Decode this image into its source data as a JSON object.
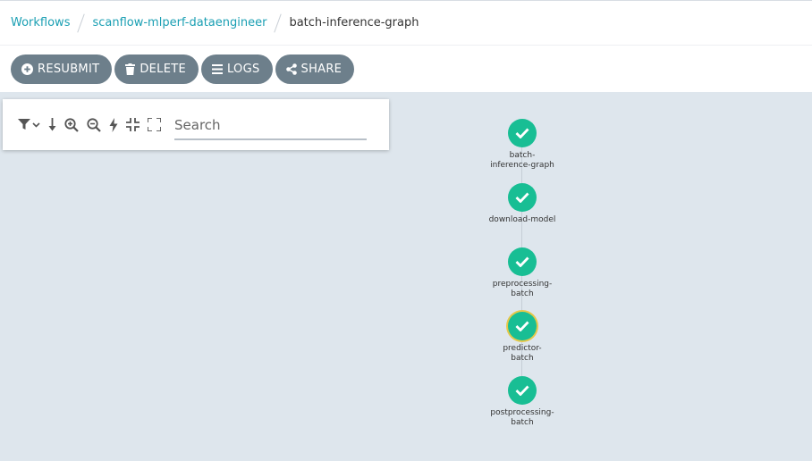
{
  "breadcrumb": {
    "root": "Workflows",
    "parent": "scanflow-mlperf-dataengineer",
    "current": "batch-inference-graph"
  },
  "toolbar": {
    "resubmit": "RESUBMIT",
    "delete": "DELETE",
    "logs": "LOGS",
    "share": "SHARE"
  },
  "graph_tools": {
    "search_placeholder": "Search",
    "icons": [
      "filter-icon",
      "chevron-down-icon",
      "arrow-down-icon",
      "zoom-in-icon",
      "zoom-out-icon",
      "lightning-icon",
      "collapse-icon",
      "expand-icon"
    ]
  },
  "nodes": [
    {
      "label_line1": "batch-",
      "label_line2": "inference-graph",
      "status": "succeeded"
    },
    {
      "label_line1": "download-model",
      "label_line2": "",
      "status": "succeeded"
    },
    {
      "label_line1": "preprocessing-",
      "label_line2": "batch",
      "status": "succeeded"
    },
    {
      "label_line1": "predictor-",
      "label_line2": "batch",
      "status": "succeeded"
    },
    {
      "label_line1": "postprocessing-",
      "label_line2": "batch",
      "status": "succeeded"
    }
  ],
  "colors": {
    "accent": "#1a9fb3",
    "button_bg": "#6d7f8b",
    "canvas_bg": "#dee6ed",
    "success": "#18be94",
    "selected_ring": "#e6c84a"
  }
}
